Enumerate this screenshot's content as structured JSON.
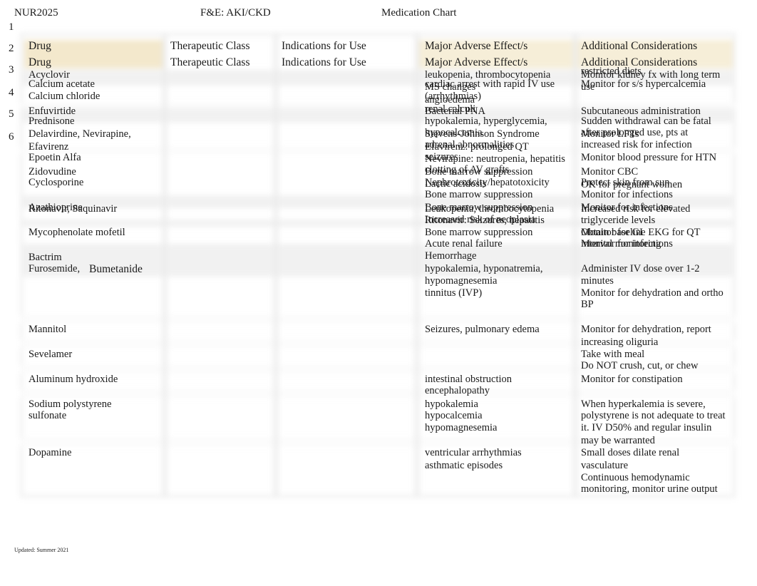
{
  "header": {
    "course": "NUR2025",
    "topic": "F&E: AKI/CKD",
    "title": "Medication Chart"
  },
  "line_numbers": [
    "1",
    "2",
    "3",
    "4",
    "5",
    "6"
  ],
  "columns": [
    "Drug",
    "Therapeutic Class",
    "Indications for Use",
    "Major Adverse Effect/s",
    "Additional Considerations"
  ],
  "columns_repeat": [
    "Drug",
    "Therapeutic Class",
    "Indications for Use",
    "Major Adverse Effect/s",
    "Additional Considerations"
  ],
  "drugs": [
    "Acyclovir",
    "Calcium acetate",
    "Calcium chloride",
    "Enfuvirtide",
    "Prednisone",
    "Delavirdine, Nevirapine,",
    "Efavirenz",
    "Epoetin Alfa",
    "Zidovudine",
    "Cyclosporine",
    "Azathioprine",
    "Ritonavir, Saquinavir",
    "Mycophenolate mofetil",
    "Bactrim",
    "Furosemide,",
    "Bumetanide",
    "Mannitol",
    "Sevelamer",
    "Aluminum hydroxide",
    "Sodium polystyrene",
    "sulfonate",
    "Dopamine"
  ],
  "adverse_effects": [
    "leukopenia, thrombocytopenia",
    "cardiac arrest with rapid IV use",
    "MS changes",
    "(arrhythmias)",
    "angioedema",
    "renal calculi",
    "Bacterial PNA",
    "hypokalemia, hyperglycemia,",
    "hypocalcemia",
    "Stevens-Johnson Syndrome",
    "adrenal abnormalities",
    "Efavirenz: prolonged QT",
    "seizures",
    "Nevirapine: neutropenia, hepatitis",
    "clotting of AV grafts",
    "Bone marrow suppression",
    "Nephrotoxicity/hepatotoxicity",
    "Lactic acidosis",
    "Bone marrow suppression",
    "Bone marrow suppression",
    "Leukopenia, thrombocytopenia",
    "Increased risk of neoplasia",
    "Ritonavir: Seizures, hepatitis",
    "Bone marrow suppression",
    "Acute renal failure",
    "Hemorrhage",
    "hypokalemia, hyponatremia,",
    "hypomagnesemia",
    "tinnitus (IVP)",
    "Seizures, pulmonary edema",
    "intestinal obstruction",
    "encephalopathy",
    "hypokalemia",
    "hypocalcemia",
    "hypomagnesemia",
    "ventricular arrhythmias",
    "asthmatic episodes"
  ],
  "considerations": [
    "restricted diets",
    "Monitor kidney fx with long term",
    "use",
    "Monitor for s/s hypercalcemia",
    "Subcutaneous administration",
    "Sudden withdrawal can be fatal",
    "after prolonged use, pts at",
    "Monitor LFTs",
    "increased risk for infection",
    "Monitor blood pressure for HTN",
    "Monitor CBC",
    "Protect skin from sun",
    "OK for pregnant women",
    "Monitor for infections",
    "Monitor for infections",
    "Increased risk for elevated",
    "triglyceride levels",
    "Obtain baseline EKG for QT",
    "Monitor for GI",
    "Monitor for infections",
    "interval monitoring",
    "Administer IV dose over 1-2",
    "minutes",
    "Monitor for dehydration and ortho",
    "BP",
    "Monitor for dehydration, report",
    "increasing oliguria",
    "Take with meal",
    "Do NOT crush, cut, or chew",
    "Monitor for constipation",
    "When hyperkalemia is severe,",
    "polystyrene is not adequate to treat",
    "it. IV D50% and regular insulin",
    "may be warranted",
    "Small doses dilate renal",
    "vasculature",
    "Continuous hemodynamic",
    "monitoring, monitor urine output"
  ],
  "footer": "Updated: Summer 2021"
}
